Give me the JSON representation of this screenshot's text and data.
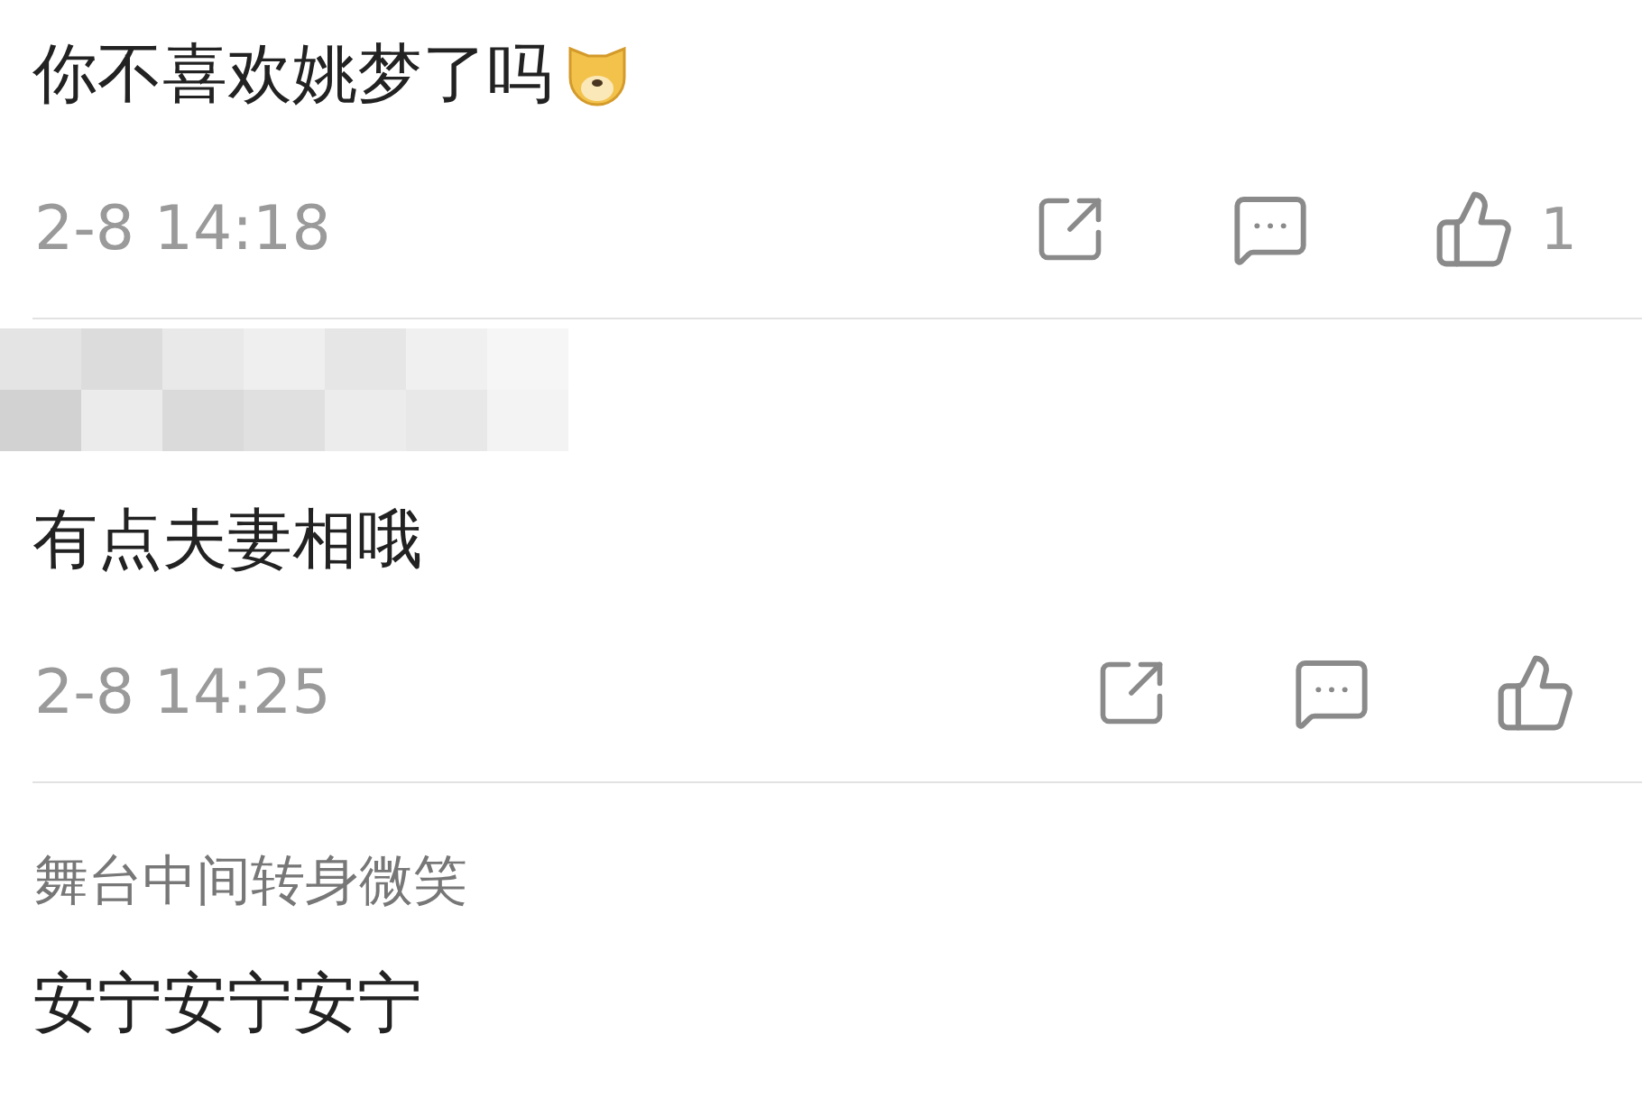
{
  "comments": [
    {
      "name_blurred": false,
      "text": "你不喜欢姚梦了吗",
      "emoji": true,
      "time": "2-8 14:18",
      "likes": "1"
    },
    {
      "name_blurred": true,
      "text": "有点夫妻相哦",
      "emoji": false,
      "time": "2-8 14:25"
    },
    {
      "name_blurred": false,
      "username": "舞台中间转身微笑",
      "text": "安宁安宁安宁",
      "emoji": false
    }
  ]
}
